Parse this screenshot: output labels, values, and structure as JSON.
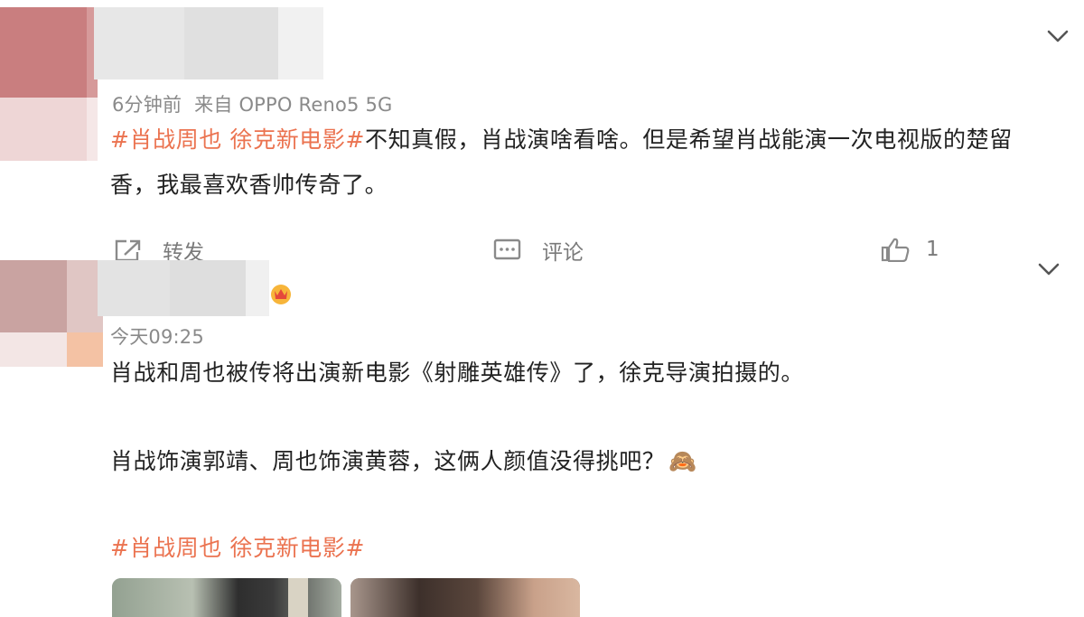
{
  "posts": [
    {
      "meta": {
        "time": "6分钟前",
        "source": "来自 OPPO Reno5 5G"
      },
      "tag": "#肖战周也 徐克新电影#",
      "text_line1": "不知真假，肖战演啥看啥。但是希望肖战能演一次电视版的楚留",
      "text_line2": "香，我最喜欢香帅传奇了。",
      "actions": {
        "repost": "转发",
        "comment": "评论",
        "like_count": "1"
      },
      "icons": {
        "repost": "repost-icon",
        "comment": "comment-icon",
        "like": "thumbs-up-icon",
        "expand": "chevron-down-icon"
      }
    },
    {
      "meta": {
        "time": "今天09:25"
      },
      "text_line1": "肖战和周也被传将出演新电影《射雕英雄传》了，徐克导演拍摄的。",
      "text_line2": "肖战饰演郭靖、周也饰演黄蓉，这俩人颜值没得挑吧？",
      "emoji": "🙈",
      "tag": "#肖战周也 徐克新电影#",
      "icons": {
        "badge": "crown-badge-icon",
        "expand": "chevron-down-icon"
      }
    }
  ],
  "colors": {
    "accent": "#eb7350",
    "meta": "#8a8a8a",
    "text": "#222222"
  }
}
